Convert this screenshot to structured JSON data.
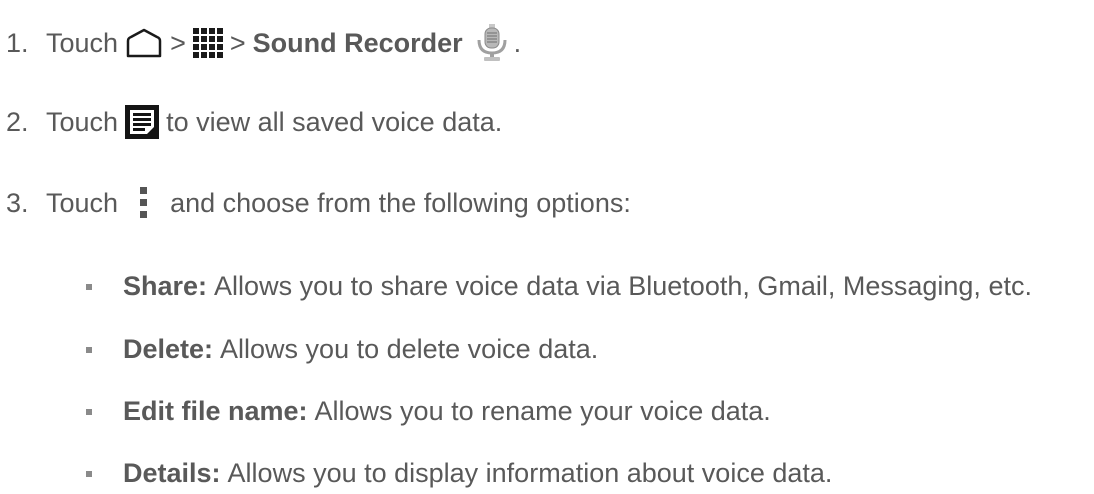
{
  "steps": [
    {
      "number": "1.",
      "touch": "Touch",
      "sep1": ">",
      "sep2": ">",
      "app_name": "Sound Recorder",
      "end": ".",
      "icons": [
        "home-icon",
        "apps-grid-icon",
        "sound-recorder-app-icon"
      ]
    },
    {
      "number": "2.",
      "touch": "Touch",
      "text": "to view all saved voice data.",
      "icons": [
        "list-icon"
      ]
    },
    {
      "number": "3.",
      "touch": "Touch",
      "text": "and choose from the following options:",
      "icons": [
        "menu-icon"
      ]
    }
  ],
  "options": [
    {
      "label": "Share:",
      "text": "Allows you to share voice data via Bluetooth, Gmail, Messaging, etc."
    },
    {
      "label": "Delete:",
      "text": "Allows you to delete voice data."
    },
    {
      "label": "Edit file name:",
      "text": "Allows you to rename your voice data."
    },
    {
      "label": "Details:",
      "text": "Allows you to display information about voice data."
    }
  ],
  "colors": {
    "text": "#595959",
    "bullet": "#8a8a8a",
    "icon_dark": "#1a1a1a"
  }
}
